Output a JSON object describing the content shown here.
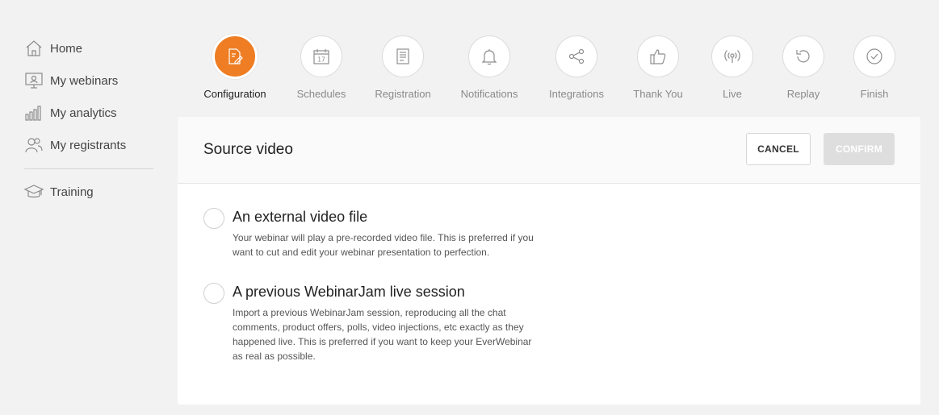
{
  "sidebar": {
    "items": [
      {
        "label": "Home",
        "icon": "home-icon"
      },
      {
        "label": "My webinars",
        "icon": "monitor-icon"
      },
      {
        "label": "My analytics",
        "icon": "analytics-icon"
      },
      {
        "label": "My registrants",
        "icon": "users-icon"
      }
    ],
    "secondary": [
      {
        "label": "Training",
        "icon": "graduation-cap-icon"
      }
    ]
  },
  "steps": [
    {
      "label": "Configuration",
      "icon": "edit-document-icon",
      "active": true
    },
    {
      "label": "Schedules",
      "icon": "calendar-icon",
      "calendar_day": "17"
    },
    {
      "label": "Registration",
      "icon": "form-icon"
    },
    {
      "label": "Notifications",
      "icon": "bell-icon"
    },
    {
      "label": "Integrations",
      "icon": "share-icon"
    },
    {
      "label": "Thank You",
      "icon": "thumbs-up-icon"
    },
    {
      "label": "Live",
      "icon": "broadcast-icon"
    },
    {
      "label": "Replay",
      "icon": "replay-icon"
    },
    {
      "label": "Finish",
      "icon": "check-circle-icon"
    }
  ],
  "card": {
    "title": "Source video",
    "cancel_label": "CANCEL",
    "confirm_label": "CONFIRM",
    "options": [
      {
        "title": "An external video file",
        "description": "Your webinar will play a pre-recorded video file. This is preferred if you want to cut and edit your webinar presentation to perfection."
      },
      {
        "title": "A previous WebinarJam live session",
        "description": "Import a previous WebinarJam session, reproducing all the chat comments, product offers, polls, video injections, etc exactly as they happened live. This is preferred if you want to keep your EverWebinar as real as possible."
      }
    ]
  },
  "colors": {
    "accent": "#ee7d23",
    "confirm_disabled": "#dedede",
    "background": "#f2f2f2"
  }
}
